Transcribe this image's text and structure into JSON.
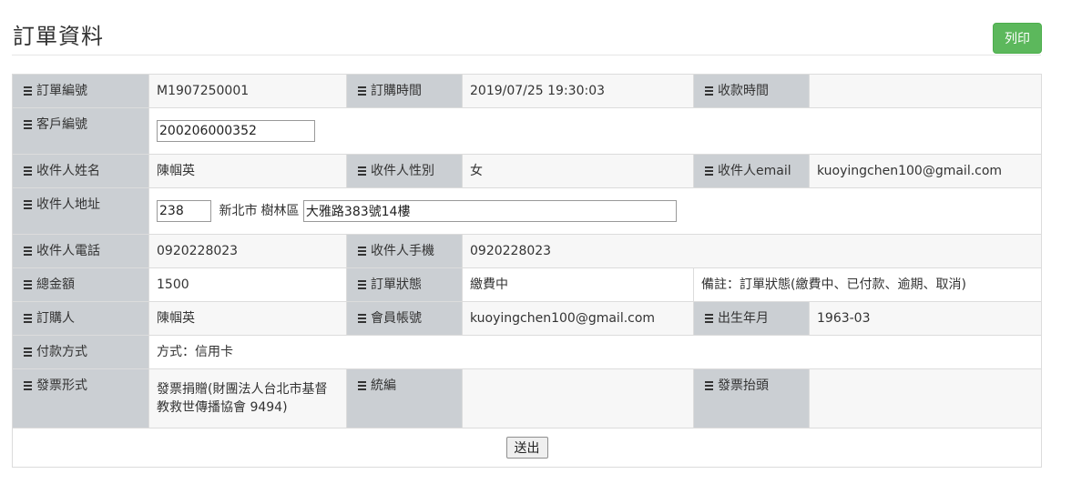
{
  "page": {
    "title": "訂單資料",
    "print_label": "列印"
  },
  "order": {
    "order_no_label": "訂單編號",
    "order_no": "M1907250001",
    "order_time_label": "訂購時間",
    "order_time": "2019/07/25 19:30:03",
    "paid_time_label": "收款時間",
    "paid_time": "",
    "customer_no_label": "客戶編號",
    "customer_no": "200206000352",
    "recipient_name_label": "收件人姓名",
    "recipient_name": "陳帼英",
    "recipient_gender_label": "收件人性別",
    "recipient_gender": "女",
    "recipient_email_label": "收件人email",
    "recipient_email": "kuoyingchen100@gmail.com",
    "recipient_address_label": "收件人地址",
    "zip": "238",
    "city": "新北市",
    "district": "樹林區",
    "street": "大雅路383號14樓",
    "recipient_phone_label": "收件人電話",
    "recipient_phone": "0920228023",
    "recipient_mobile_label": "收件人手機",
    "recipient_mobile": "0920228023",
    "total_label": "總金額",
    "total": "1500",
    "status_label": "訂單狀態",
    "status": "繳費中",
    "status_note": "備註：訂單狀態(繳費中、已付款、逾期、取消)",
    "buyer_label": "訂購人",
    "buyer": "陳帼英",
    "member_account_label": "會員帳號",
    "member_account": "kuoyingchen100@gmail.com",
    "birth_label": "出生年月",
    "birth": "1963-03",
    "payment_label": "付款方式",
    "payment": "方式：信用卡",
    "invoice_type_label": "發票形式",
    "invoice_type": "發票捐贈(財團法人台北市基督教救世傳播協會 9494)",
    "tax_id_label": "統編",
    "tax_id": "",
    "invoice_title_label": "發票抬頭",
    "invoice_title": "",
    "submit_label": "送出"
  },
  "colors": {
    "label_bg": "#cbcfd3",
    "alt_row_bg": "#f7f7f7",
    "print_btn": "#5cb85c"
  },
  "icons": {
    "label_icon": "list-icon"
  }
}
